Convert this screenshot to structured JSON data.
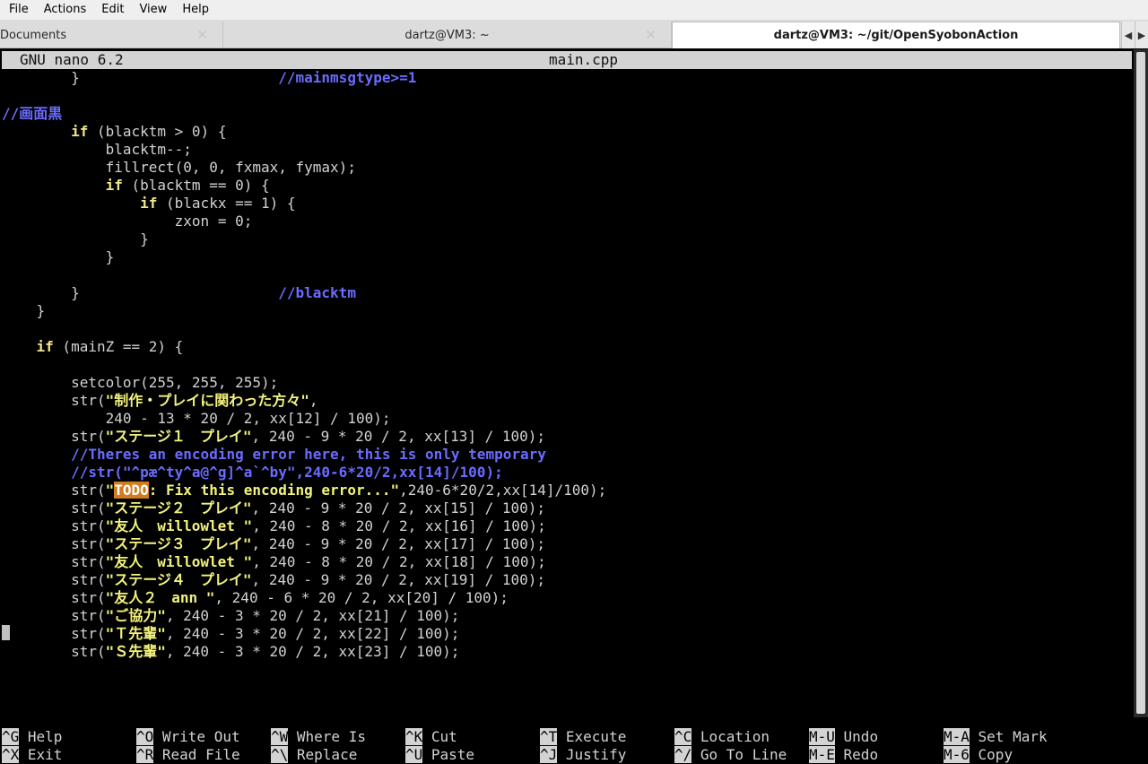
{
  "menu": [
    "File",
    "Actions",
    "Edit",
    "View",
    "Help"
  ],
  "tabs": [
    {
      "label": "Documents"
    },
    {
      "label": "dartz@VM3: ~"
    },
    {
      "label": "dartz@VM3: ~/git/OpenSyobonAction"
    }
  ],
  "tab_close_glyph": "✕",
  "nano": {
    "app": "GNU nano 6.2",
    "filename": "main.cpp"
  },
  "code_lines": [
    [
      [
        "        }                       ",
        ""
      ],
      [
        "//mainmsgtype>=1",
        "cm"
      ]
    ],
    [],
    [
      [
        "//画面黒",
        "cm"
      ]
    ],
    [
      [
        "        ",
        ""
      ],
      [
        "if",
        "kw"
      ],
      [
        " (blacktm > 0) {",
        ""
      ]
    ],
    [
      [
        "            blacktm--;",
        ""
      ]
    ],
    [
      [
        "            fillrect(0, 0, fxmax, fymax);",
        ""
      ]
    ],
    [
      [
        "            ",
        ""
      ],
      [
        "if",
        "kw"
      ],
      [
        " (blacktm == 0) {",
        ""
      ]
    ],
    [
      [
        "                ",
        ""
      ],
      [
        "if",
        "kw"
      ],
      [
        " (blackx == 1) {",
        ""
      ]
    ],
    [
      [
        "                    zxon = 0;",
        ""
      ]
    ],
    [
      [
        "                }",
        ""
      ]
    ],
    [
      [
        "            }",
        ""
      ]
    ],
    [],
    [
      [
        "        }                       ",
        ""
      ],
      [
        "//blacktm",
        "cm"
      ]
    ],
    [
      [
        "    }",
        ""
      ]
    ],
    [],
    [
      [
        "    ",
        ""
      ],
      [
        "if",
        "kw"
      ],
      [
        " (mainZ == 2) {",
        ""
      ]
    ],
    [],
    [
      [
        "        setcolor(255, 255, 255);",
        ""
      ]
    ],
    [
      [
        "        str(",
        ""
      ],
      [
        "\"制作・プレイに関わった方々\"",
        "str"
      ],
      [
        ",",
        ""
      ]
    ],
    [
      [
        "            240 - 13 * 20 / 2, xx[12] / 100);",
        ""
      ]
    ],
    [
      [
        "        str(",
        ""
      ],
      [
        "\"ステージ１　プレイ\"",
        "str"
      ],
      [
        ", 240 - 9 * 20 / 2, xx[13] / 100);",
        ""
      ]
    ],
    [
      [
        "        ",
        ""
      ],
      [
        "//Theres an encoding error here, this is only temporary",
        "cm"
      ]
    ],
    [
      [
        "        ",
        ""
      ],
      [
        "//str(\"^pæ^ty^a@^g]^a`^by\",240-6*20/2,xx[14]/100);",
        "cm"
      ]
    ],
    [
      [
        "        str(",
        ""
      ],
      [
        "\"",
        "str"
      ],
      [
        "TODO",
        "todo"
      ],
      [
        ": Fix this encoding error...\"",
        "str"
      ],
      [
        ",240-6*20/2,xx[14]/100);",
        ""
      ]
    ],
    [
      [
        "        str(",
        ""
      ],
      [
        "\"ステージ２　プレイ\"",
        "str"
      ],
      [
        ", 240 - 9 * 20 / 2, xx[15] / 100);",
        ""
      ]
    ],
    [
      [
        "        str(",
        ""
      ],
      [
        "\"友人　willowlet \"",
        "str"
      ],
      [
        ", 240 - 8 * 20 / 2, xx[16] / 100);",
        ""
      ]
    ],
    [
      [
        "        str(",
        ""
      ],
      [
        "\"ステージ３　プレイ\"",
        "str"
      ],
      [
        ", 240 - 9 * 20 / 2, xx[17] / 100);",
        ""
      ]
    ],
    [
      [
        "        str(",
        ""
      ],
      [
        "\"友人　willowlet \"",
        "str"
      ],
      [
        ", 240 - 8 * 20 / 2, xx[18] / 100);",
        ""
      ]
    ],
    [
      [
        "        str(",
        ""
      ],
      [
        "\"ステージ４　プレイ\"",
        "str"
      ],
      [
        ", 240 - 9 * 20 / 2, xx[19] / 100);",
        ""
      ]
    ],
    [
      [
        "        str(",
        ""
      ],
      [
        "\"友人２　ann \"",
        "str"
      ],
      [
        ", 240 - 6 * 20 / 2, xx[20] / 100);",
        ""
      ]
    ],
    [
      [
        "        str(",
        ""
      ],
      [
        "\"ご協力\"",
        "str"
      ],
      [
        ", 240 - 3 * 20 / 2, xx[21] / 100);",
        ""
      ]
    ],
    [
      [
        "        str(",
        ""
      ],
      [
        "\"Ｔ先輩\"",
        "str"
      ],
      [
        ", 240 - 3 * 20 / 2, xx[22] / 100);",
        ""
      ]
    ],
    [
      [
        "        str(",
        ""
      ],
      [
        "\"Ｓ先輩\"",
        "str"
      ],
      [
        ", 240 - 3 * 20 / 2, xx[23] / 100);",
        ""
      ]
    ]
  ],
  "shortcuts": [
    [
      {
        "key": "^G",
        "label": "Help"
      },
      {
        "key": "^X",
        "label": "Exit"
      }
    ],
    [
      {
        "key": "^O",
        "label": "Write Out"
      },
      {
        "key": "^R",
        "label": "Read File"
      }
    ],
    [
      {
        "key": "^W",
        "label": "Where Is"
      },
      {
        "key": "^\\",
        "label": "Replace"
      }
    ],
    [
      {
        "key": "^K",
        "label": "Cut"
      },
      {
        "key": "^U",
        "label": "Paste"
      }
    ],
    [
      {
        "key": "^T",
        "label": "Execute"
      },
      {
        "key": "^J",
        "label": "Justify"
      }
    ],
    [
      {
        "key": "^C",
        "label": "Location"
      },
      {
        "key": "^/",
        "label": "Go To Line"
      }
    ],
    [
      {
        "key": "M-U",
        "label": "Undo"
      },
      {
        "key": "M-E",
        "label": "Redo"
      }
    ],
    [
      {
        "key": "M-A",
        "label": "Set Mark"
      },
      {
        "key": "M-6",
        "label": "Copy"
      }
    ]
  ],
  "colors": {
    "comment": "#6b6bff",
    "keyword": "#f0e68c",
    "string": "#f3f37d",
    "todo": "#d17d1f"
  },
  "icons": {
    "tab_left": "chevron-left-icon",
    "tab_right": "chevron-right-icon",
    "tab_close": "close-icon"
  }
}
